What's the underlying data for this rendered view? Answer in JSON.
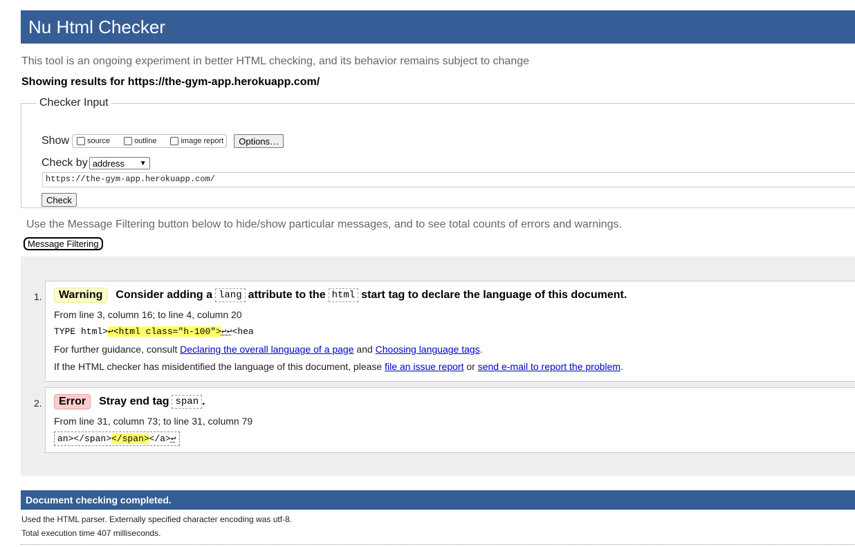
{
  "header": {
    "title": "Nu Html Checker"
  },
  "intro": "This tool is an ongoing experiment in better HTML checking, and its behavior remains subject to change",
  "showing": "Showing results for https://the-gym-app.herokuapp.com/",
  "checker_input": {
    "legend": "Checker Input",
    "show_label": "Show",
    "options": [
      "source",
      "outline",
      "image report"
    ],
    "options_button": "Options…",
    "check_by_label": "Check by",
    "check_by_value": "address",
    "url_value": "https://the-gym-app.herokuapp.com/",
    "check_button": "Check"
  },
  "filtering": {
    "text": "Use the Message Filtering button below to hide/show particular messages, and to see total counts of errors and warnings.",
    "button": "Message Filtering"
  },
  "messages": [
    {
      "num": "1.",
      "type": "Warning",
      "title_parts": [
        "Consider adding a",
        "lang",
        "attribute to the",
        "html",
        "start tag to declare the language of this document."
      ],
      "location": "From line 3, column 16; to line 4, column 20",
      "extract": {
        "pre": "TYPE html>",
        "ret1": "↩",
        "hl": "<html class=\"h-100\">",
        "post_ret": "↩↩",
        "post": "<hea"
      },
      "guidance": {
        "prefix": "For further guidance, consult",
        "link1": "Declaring the overall language of a page",
        "mid": "and",
        "link2": "Choosing language tags",
        "suffix": "."
      },
      "misidentified": {
        "prefix": "If the HTML checker has misidentified the language of this document, please",
        "link1": "file an issue report",
        "mid": "or",
        "link2": "send e-mail to report the problem",
        "suffix": "."
      }
    },
    {
      "num": "2.",
      "type": "Error",
      "title_parts": [
        "Stray end tag",
        "span",
        "."
      ],
      "location": "From line 31, column 73; to line 31, column 79",
      "extract": {
        "pre": "an></span>",
        "hl": "</span>",
        "post": "</a>",
        "ret": "↩"
      }
    }
  ],
  "footer": {
    "done": "Document checking completed.",
    "parser": "Used the HTML parser. Externally specified character encoding was utf-8.",
    "time": "Total execution time 407 milliseconds."
  },
  "colors": {
    "brand": "#365d95",
    "warning_bg": "#ffffcc",
    "error_bg": "#ffcccc",
    "highlight": "#ffff66",
    "link": "#0000cc"
  }
}
